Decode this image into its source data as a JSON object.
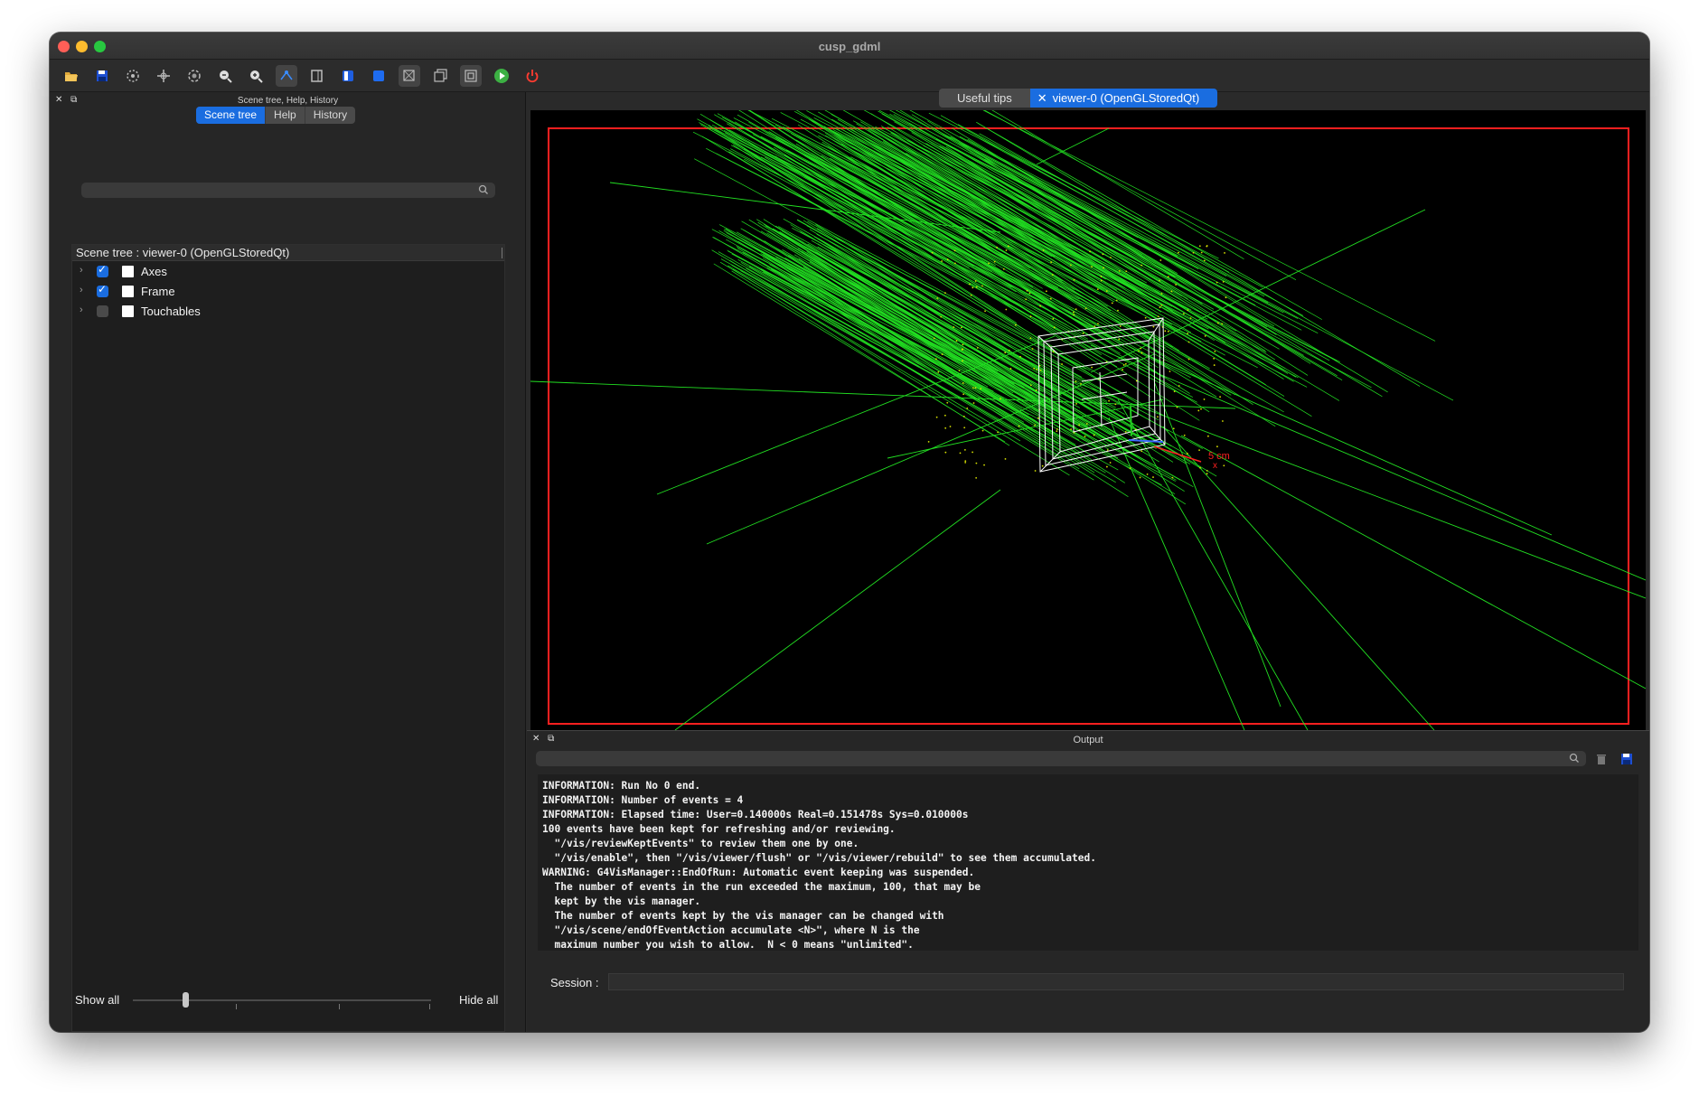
{
  "window": {
    "title": "cusp_gdml"
  },
  "toolbar": {
    "icons": [
      "open-folder-icon",
      "save-icon",
      "rotate-icon",
      "move-icon",
      "pick-icon",
      "zoom-out-icon",
      "zoom-in-icon",
      "perspective-icon",
      "hidden-line-icon",
      "solid-surface-icon",
      "solid-icon",
      "wireframe-icon",
      "hidden-line-removal-icon",
      "perspective-view-icon",
      "orthogonal-view-icon",
      "run-beam-on-icon",
      "quit-icon"
    ]
  },
  "left_dock": {
    "title": "Scene tree, Help, History",
    "tabs": [
      "Scene tree",
      "Help",
      "History"
    ],
    "active_tab": "Scene tree",
    "search": {
      "placeholder": ""
    },
    "tree_header": "Scene tree : viewer-0 (OpenGLStoredQt)",
    "items": [
      {
        "label": "Axes",
        "checked": true
      },
      {
        "label": "Frame",
        "checked": true
      },
      {
        "label": "Touchables",
        "checked": false
      }
    ],
    "slider": {
      "left_label": "Show all",
      "right_label": "Hide all",
      "value": 0
    }
  },
  "viewer": {
    "tabs": [
      "Useful tips",
      "viewer-0 (OpenGLStoredQt)"
    ],
    "active_tab": "viewer-0 (OpenGLStoredQt)",
    "scale_label": "5 cm",
    "axis_label": "x",
    "frame_color": "#ff1f1f",
    "track_color": "#22e022"
  },
  "output": {
    "title": "Output",
    "lines": [
      "INFORMATION: Run No 0 end.",
      "INFORMATION: Number of events = 4",
      "INFORMATION: Elapsed time: User=0.140000s Real=0.151478s Sys=0.010000s",
      "100 events have been kept for refreshing and/or reviewing.",
      "  \"/vis/reviewKeptEvents\" to review them one by one.",
      "  \"/vis/enable\", then \"/vis/viewer/flush\" or \"/vis/viewer/rebuild\" to see them accumulated.",
      "WARNING: G4VisManager::EndOfRun: Automatic event keeping was suspended.",
      "  The number of events in the run exceeded the maximum, 100, that may be",
      "  kept by the vis manager.",
      "  The number of events kept by the vis manager can be changed with",
      "  \"/vis/scene/endOfEventAction accumulate <N>\", where N is the",
      "  maximum number you wish to allow.  N < 0 means \"unlimited\"."
    ],
    "session_label": "Session :",
    "session_value": ""
  }
}
